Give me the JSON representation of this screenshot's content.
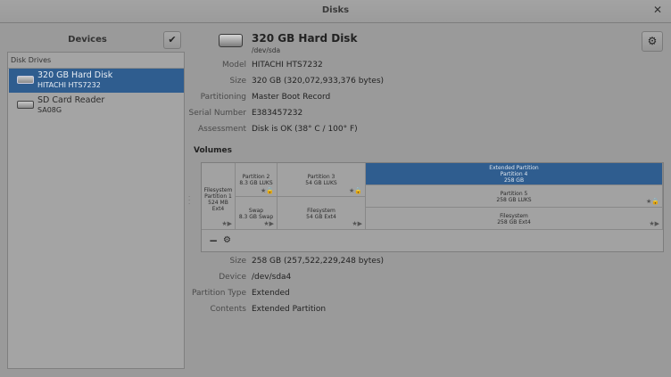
{
  "window": {
    "title": "Disks"
  },
  "sidebar": {
    "title": "Devices",
    "check_glyph": "✔",
    "section": "Disk Drives",
    "devices": [
      {
        "name": "320 GB Hard Disk",
        "sub": "HITACHI HTS7232"
      },
      {
        "name": "SD Card Reader",
        "sub": "SA08G"
      }
    ]
  },
  "disk": {
    "title": "320 GB Hard Disk",
    "path": "/dev/sda",
    "props": [
      {
        "label": "Model",
        "value": "HITACHI HTS7232"
      },
      {
        "label": "Size",
        "value": "320 GB (320,072,933,376 bytes)"
      },
      {
        "label": "Partitioning",
        "value": "Master Boot Record"
      },
      {
        "label": "Serial Number",
        "value": "E383457232"
      },
      {
        "label": "Assessment",
        "value": "Disk is OK (38° C / 100° F)"
      }
    ]
  },
  "volumes": {
    "title": "Volumes",
    "p1": {
      "l1": "Filesystem",
      "l2": "Partition 1",
      "l3": "524 MB Ext4"
    },
    "p2": {
      "l1": "Partition 2",
      "l2": "8.3 GB LUKS"
    },
    "p3": {
      "l1": "Partition 3",
      "l2": "54 GB LUKS"
    },
    "p4": {
      "l1": "Extended Partition",
      "l2": "Partition 4",
      "l3": "258 GB"
    },
    "swap": {
      "l1": "Swap",
      "l2": "8.3 GB Swap"
    },
    "fs3": {
      "l1": "Filesystem",
      "l2": "54 GB Ext4"
    },
    "p5": {
      "l1": "Partition 5",
      "l2": "258 GB LUKS"
    },
    "fs5": {
      "l1": "Filesystem",
      "l2": "258 GB Ext4"
    },
    "star_lock": "★🔒",
    "star_play": "★▶",
    "minus": "−"
  },
  "selected": {
    "props": [
      {
        "label": "Size",
        "value": "258 GB (257,522,229,248 bytes)"
      },
      {
        "label": "Device",
        "value": "/dev/sda4"
      },
      {
        "label": "Partition Type",
        "value": "Extended"
      },
      {
        "label": "Contents",
        "value": "Extended Partition"
      }
    ]
  }
}
